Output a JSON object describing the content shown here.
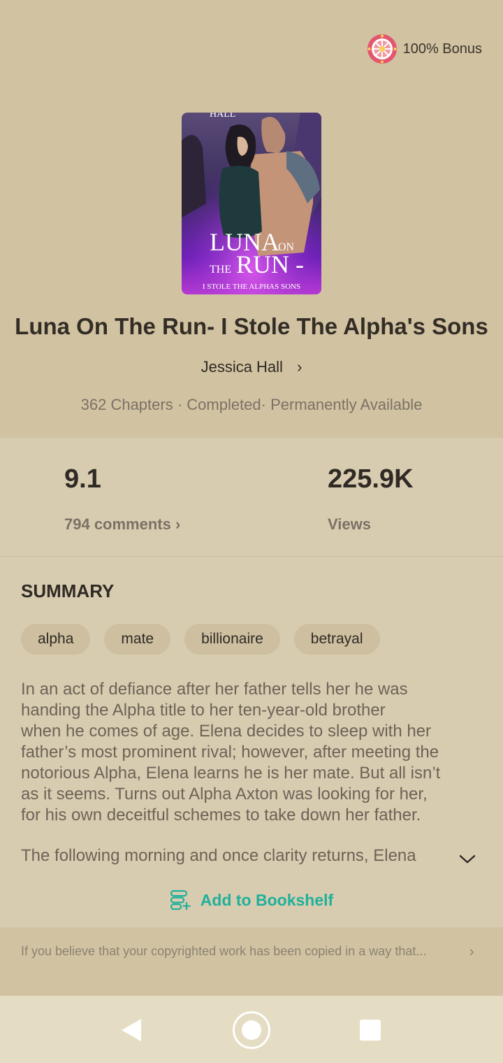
{
  "bonus": {
    "label": "100% Bonus",
    "icon": "bonus-wheel-icon"
  },
  "cover": {
    "top_text": "HALL",
    "title_line1": "LUNA",
    "title_on": "ON",
    "title_the": "THE",
    "title_run": "RUN -",
    "subtitle": "I STOLE THE ALPHAS SONS"
  },
  "book": {
    "title": "Luna On The Run- I Stole The Alpha's Sons",
    "author": "Jessica Hall",
    "meta": "362 Chapters · Completed· Permanently Available"
  },
  "stats": {
    "rating": "9.1",
    "comments": "794 comments",
    "views": "225.9K",
    "views_label": "Views"
  },
  "summary": {
    "heading": "SUMMARY",
    "tags": [
      "alpha",
      "mate",
      "billionaire",
      "betrayal"
    ],
    "lines1": [
      "In an act of defiance after her father tells her he was",
      "handing the Alpha title to her ten-year-old brother",
      "when he comes of age. Elena decides to sleep with her",
      "father’s most prominent rival; however, after meeting the",
      "notorious Alpha, Elena learns he is her mate. But all isn’t",
      "as it seems. Turns out Alpha Axton was looking for her,",
      "for his own deceitful schemes to take down her father."
    ],
    "line2": "The following morning and once clarity returns, Elena"
  },
  "actions": {
    "add_to_bookshelf": "Add to Bookshelf"
  },
  "notice": {
    "text": "If you believe that your copyrighted work has been copied in a way that..."
  },
  "colors": {
    "accent": "#21b09a",
    "background": "#d1c2a1",
    "panel": "#d8ccb0"
  }
}
